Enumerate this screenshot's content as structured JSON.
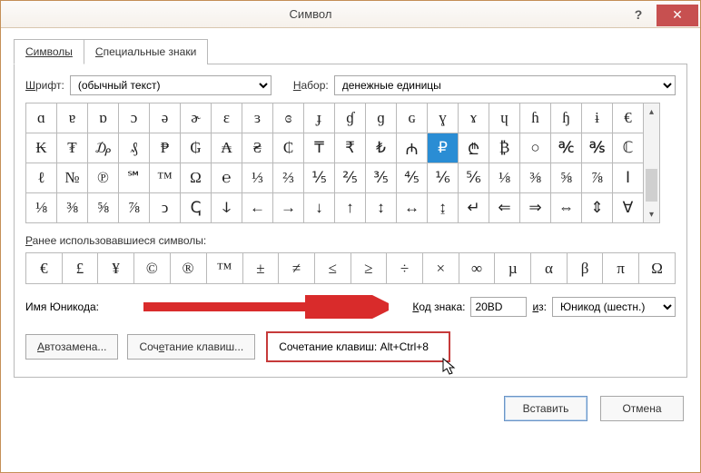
{
  "window": {
    "title": "Символ",
    "help_tooltip": "?",
    "close_tooltip": "✕"
  },
  "tabs": {
    "symbols": "Символы",
    "special": "Специальные знаки"
  },
  "font_row": {
    "label_pre": "Ш",
    "label_post": "рифт:",
    "value": "(обычный текст)",
    "subset_label_pre": "Н",
    "subset_label_post": "абор:",
    "subset_value": "денежные единицы"
  },
  "grid_rows": [
    [
      "ɑ",
      "ɐ",
      "ɒ",
      "ɔ",
      "ə",
      "ɚ",
      "ɛ",
      "ɜ",
      "ɞ",
      "ɟ",
      "ɠ",
      "ɡ",
      "ɢ",
      "ɣ",
      "ɤ",
      "ɥ",
      "ɦ",
      "ɧ",
      "ɨ",
      "€"
    ],
    [
      "₭",
      "₮",
      "₯",
      "₰",
      "₱",
      "₲",
      "₳",
      "₴",
      "₵",
      "₸",
      "₹",
      "₺",
      "₼",
      "₽",
      "₾",
      "₿",
      "○",
      "℀",
      "℁",
      "ℂ"
    ],
    [
      "ℓ",
      "№",
      "℗",
      "℠",
      "™",
      "Ω",
      "℮",
      "⅓",
      "⅔",
      "⅕",
      "⅖",
      "⅗",
      "⅘",
      "⅙",
      "⅚",
      "⅛",
      "⅜",
      "⅝",
      "⅞",
      "Ⅰ"
    ],
    [
      "⅛",
      "⅜",
      "⅝",
      "⅞",
      "ↄ",
      "ↅ",
      "ↆ",
      "←",
      "→",
      "↓",
      "↑",
      "↕",
      "↔",
      "↨",
      "↵",
      "⇐",
      "⇒",
      "⇔",
      "⇕",
      "∀"
    ]
  ],
  "grid_selected": {
    "row": 1,
    "col": 13
  },
  "recent_label_pre": "Р",
  "recent_label_post": "анее использовавшиеся символы:",
  "recent_row": [
    "€",
    "£",
    "¥",
    "©",
    "®",
    "™",
    "±",
    "≠",
    "≤",
    "≥",
    "÷",
    "×",
    "∞",
    "µ",
    "α",
    "β",
    "π",
    "Ω"
  ],
  "unicode_name_label": "Имя Юникода:",
  "unicode_name_value": "",
  "code_label_pre": "К",
  "code_label_post": "од знака:",
  "code_value": "20BD",
  "from_label_pre": "и",
  "from_label_post": "з:",
  "from_value": "Юникод (шестн.)",
  "buttons": {
    "autocorrect": "Автозамена...",
    "shortcut": "Сочетание клавиш...",
    "shortcut_info": "Сочетание клавиш: Alt+Ctrl+8",
    "insert": "Вставить",
    "cancel": "Отмена"
  }
}
